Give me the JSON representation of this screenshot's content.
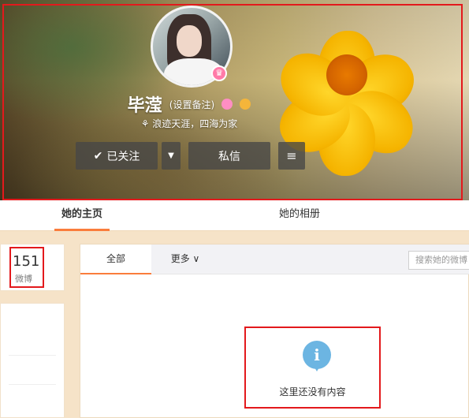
{
  "profile": {
    "name": "毕滢",
    "remark": "(设置备注)",
    "bio": "浪迹天涯，四海为家"
  },
  "actions": {
    "follow_label": "已关注",
    "message_label": "私信"
  },
  "tabs": [
    {
      "label": "她的主页",
      "active": true
    },
    {
      "label": "她的相册",
      "active": false
    }
  ],
  "stats": {
    "weibo_count": "151",
    "weibo_label": "微博"
  },
  "feed": {
    "tabs": [
      {
        "label": "全部",
        "active": true
      },
      {
        "label": "更多 ∨",
        "active": false
      }
    ],
    "search_placeholder": "搜索她的微博",
    "empty_message": "这里还没有内容"
  },
  "colors": {
    "accent": "#fa7d3c",
    "annotation": "#e3191c",
    "info_icon": "#6cb5e2"
  }
}
